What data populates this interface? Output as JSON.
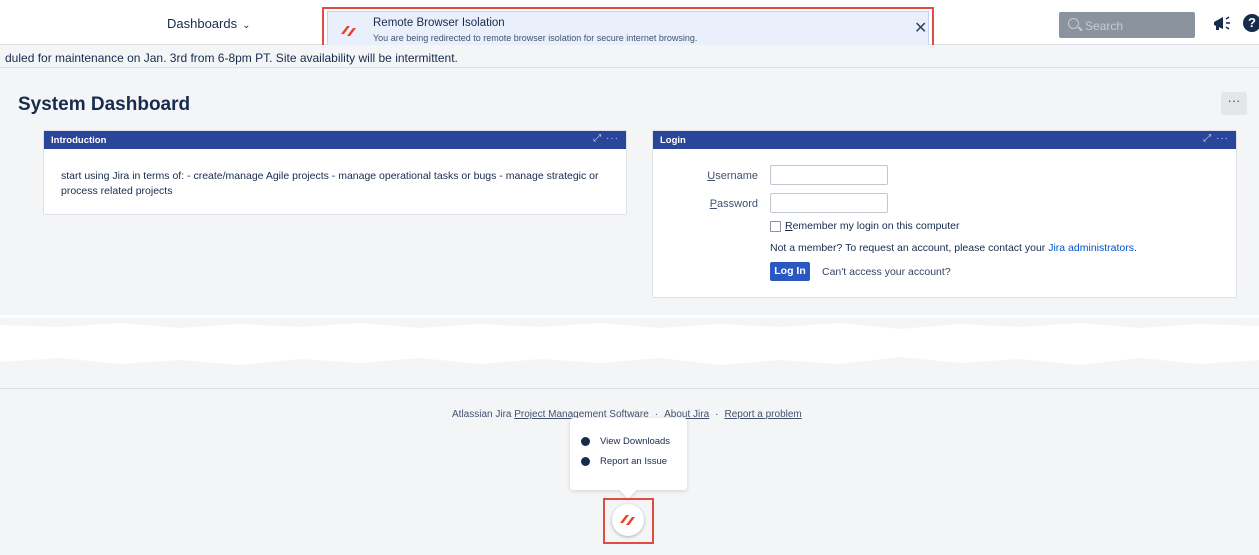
{
  "nav": {
    "dashboards_label": "Dashboards",
    "search_placeholder": "Search"
  },
  "rbi_toast": {
    "title": "Remote Browser Isolation",
    "message": "You are being redirected to remote browser isolation for secure internet browsing.",
    "close": "✕",
    "accent": "#4c8df6",
    "brand": "#e8412b"
  },
  "banner": {
    "text": "duled for maintenance on Jan. 3rd from 6-8pm PT. Site availability will be intermittent."
  },
  "page": {
    "title": "System Dashboard",
    "tools": "···"
  },
  "intro_gadget": {
    "title": "Introduction",
    "controls": "⤢ ···",
    "body": "start using Jira in terms of: - create/manage Agile projects - manage operational tasks or bugs - manage strategic or process related projects"
  },
  "login_gadget": {
    "title": "Login",
    "controls": "⤢ ···",
    "username_label_u": "U",
    "username_label_rest": "sername",
    "password_label_u": "P",
    "password_label_rest": "assword",
    "remember_u": "R",
    "remember_rest": "emember my login on this computer",
    "not_member": "Not a member? To request an account, please contact your ",
    "admin_link": "Jira administrators",
    "not_member_end": ".",
    "login_button": "Log In",
    "cant_access": "Can't access your account?"
  },
  "footer": {
    "product_prefix": "Atlassian Jira ",
    "product_link": "Project Management Software",
    "sep1": "·",
    "about": "About Jira",
    "sep2": "·",
    "report": "Report a problem"
  },
  "rbi_menu": {
    "items": [
      {
        "label": "View Downloads",
        "icon": "download-icon"
      },
      {
        "label": "Report an Issue",
        "icon": "chat-icon"
      }
    ]
  },
  "colors": {
    "gadget_header": "#2a469b",
    "primary_button": "#2a58c0",
    "highlight_frame": "#e04b42"
  }
}
